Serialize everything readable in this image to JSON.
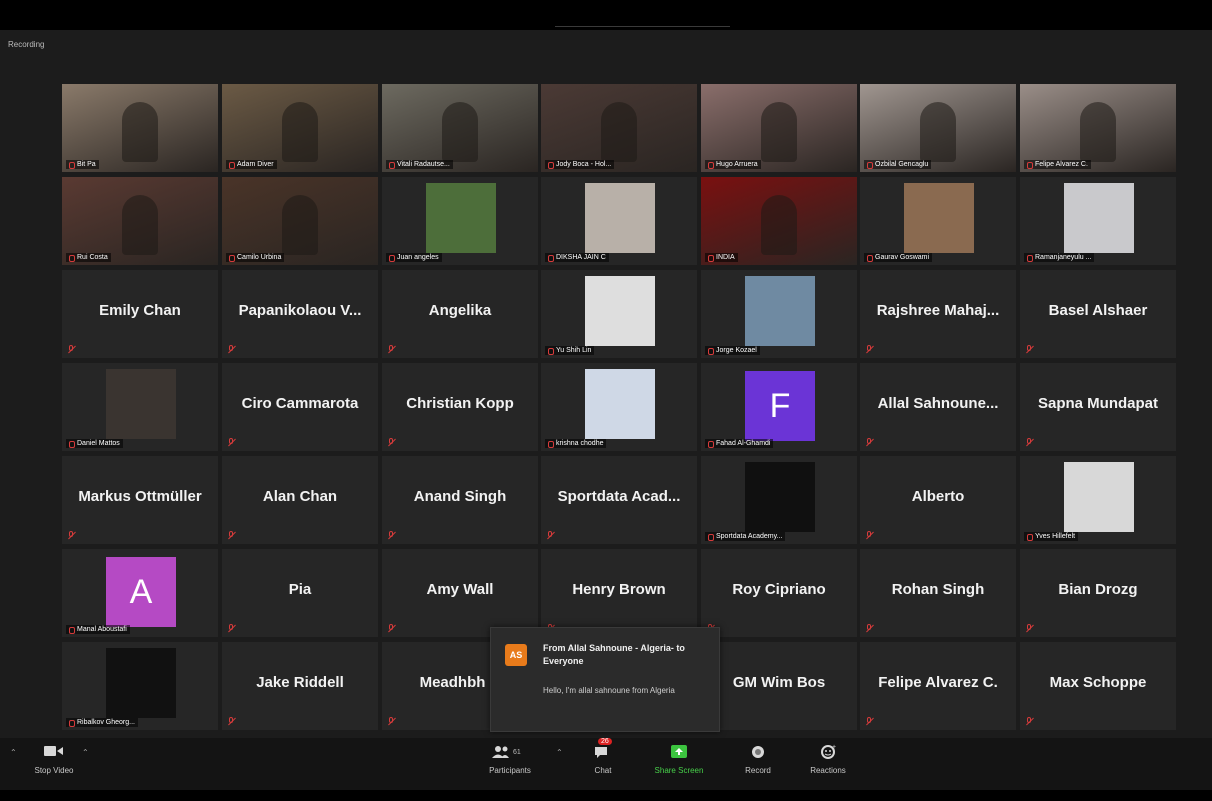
{
  "recording": "Recording",
  "tiles": [
    {
      "r": 0,
      "c": 0,
      "type": "video",
      "label": "Bit Pa",
      "active": true,
      "bg": "#8a7a6a"
    },
    {
      "r": 0,
      "c": 1,
      "type": "video",
      "label": "Adam Diver",
      "bg": "#6b5a45"
    },
    {
      "r": 0,
      "c": 2,
      "type": "video",
      "label": "Vitali Radautse...",
      "bg": "#6d6a60"
    },
    {
      "r": 0,
      "c": 3,
      "type": "video",
      "label": "Jody Boca - Hol...",
      "bg": "#4b3a35"
    },
    {
      "r": 0,
      "c": 4,
      "type": "video",
      "label": "Hugo Arruera",
      "bg": "#8a6e6b"
    },
    {
      "r": 0,
      "c": 5,
      "type": "video",
      "label": "Ozbilal Gencaglu",
      "bg": "#a09690"
    },
    {
      "r": 0,
      "c": 6,
      "type": "video",
      "label": "Felipe Alvarez C.",
      "bg": "#9a8e88"
    },
    {
      "r": 1,
      "c": 0,
      "type": "video",
      "label": "Rui Costa",
      "bg": "#5a3a32"
    },
    {
      "r": 1,
      "c": 1,
      "type": "video",
      "label": "Camilo Urbina",
      "bg": "#4a3428"
    },
    {
      "r": 1,
      "c": 2,
      "type": "thumb",
      "label": "Juan angeles",
      "bg": "#4d6e3a"
    },
    {
      "r": 1,
      "c": 3,
      "type": "thumb",
      "label": "DIKSHA JAIN C",
      "bg": "#b8b0a8"
    },
    {
      "r": 1,
      "c": 4,
      "type": "video",
      "label": "INDIA",
      "bg": "#7a1010"
    },
    {
      "r": 1,
      "c": 5,
      "type": "thumb",
      "label": "Gaurav Goswami",
      "bg": "#8a6a50"
    },
    {
      "r": 1,
      "c": 6,
      "type": "thumb",
      "label": "Ramanjaneyulu ...",
      "bg": "#c9c9cc"
    },
    {
      "r": 2,
      "c": 0,
      "type": "name",
      "name": "Emily Chan"
    },
    {
      "r": 2,
      "c": 1,
      "type": "name",
      "name": "Papanikolaou V..."
    },
    {
      "r": 2,
      "c": 2,
      "type": "name",
      "name": "Angelika"
    },
    {
      "r": 2,
      "c": 3,
      "type": "thumb",
      "label": "Yu Shih Lin",
      "bg": "#dedede"
    },
    {
      "r": 2,
      "c": 4,
      "type": "thumb",
      "label": "Jorge Kozael",
      "bg": "#6f8aa2"
    },
    {
      "r": 2,
      "c": 5,
      "type": "name",
      "name": "Rajshree  Mahaj..."
    },
    {
      "r": 2,
      "c": 6,
      "type": "name",
      "name": "Basel Alshaer"
    },
    {
      "r": 3,
      "c": 0,
      "type": "thumb",
      "label": "Daniel Mattos",
      "bg": "#3a3430"
    },
    {
      "r": 3,
      "c": 1,
      "type": "name",
      "name": "Ciro Cammarota"
    },
    {
      "r": 3,
      "c": 2,
      "type": "name",
      "name": "Christian Kopp"
    },
    {
      "r": 3,
      "c": 3,
      "type": "thumb",
      "label": "krishna chodhe",
      "bg": "#cfd8e6"
    },
    {
      "r": 3,
      "c": 4,
      "type": "avatar",
      "letter": "F",
      "label": "Fahad Al-Ghamdi",
      "bg": "#6b34d6"
    },
    {
      "r": 3,
      "c": 5,
      "type": "name",
      "name": "Allal  Sahnoune..."
    },
    {
      "r": 3,
      "c": 6,
      "type": "name",
      "name": "Sapna Mundapat"
    },
    {
      "r": 4,
      "c": 0,
      "type": "name",
      "name": "Markus Ottmüller"
    },
    {
      "r": 4,
      "c": 1,
      "type": "name",
      "name": "Alan Chan"
    },
    {
      "r": 4,
      "c": 2,
      "type": "name",
      "name": "Anand Singh"
    },
    {
      "r": 4,
      "c": 3,
      "type": "name",
      "name": "Sportdata  Acad..."
    },
    {
      "r": 4,
      "c": 4,
      "type": "thumb",
      "label": "Sportdata Academy...",
      "bg": "#101010"
    },
    {
      "r": 4,
      "c": 5,
      "type": "name",
      "name": "Alberto"
    },
    {
      "r": 4,
      "c": 6,
      "type": "thumb",
      "label": "Yves Hillefelt",
      "bg": "#d8d8d8"
    },
    {
      "r": 5,
      "c": 0,
      "type": "avatar",
      "letter": "A",
      "label": "Manal Aboustafi",
      "bg": "#b54ac4"
    },
    {
      "r": 5,
      "c": 1,
      "type": "name",
      "name": "Pia"
    },
    {
      "r": 5,
      "c": 2,
      "type": "name",
      "name": "Amy Wall"
    },
    {
      "r": 5,
      "c": 3,
      "type": "name",
      "name": "Henry Brown"
    },
    {
      "r": 5,
      "c": 4,
      "type": "name",
      "name": "Roy Cipriano"
    },
    {
      "r": 5,
      "c": 5,
      "type": "name",
      "name": "Rohan Singh"
    },
    {
      "r": 5,
      "c": 6,
      "type": "name",
      "name": "Bian Drozg"
    },
    {
      "r": 6,
      "c": 0,
      "type": "thumb",
      "label": "Ribalkov Gheorg...",
      "bg": "#111111"
    },
    {
      "r": 6,
      "c": 1,
      "type": "name",
      "name": "Jake Riddell"
    },
    {
      "r": 6,
      "c": 2,
      "type": "name",
      "name": "Meadhbh D"
    },
    {
      "r": 6,
      "c": 3,
      "type": "empty"
    },
    {
      "r": 6,
      "c": 4,
      "type": "name",
      "name": "GM Wim Bos"
    },
    {
      "r": 6,
      "c": 5,
      "type": "name",
      "name": "Felipe Alvarez C."
    },
    {
      "r": 6,
      "c": 6,
      "type": "name",
      "name": "Max Schoppe"
    }
  ],
  "toast": {
    "avatar": "AS",
    "from": "From Allal Sahnoune - Algeria- to Everyone",
    "message": "Hello, I'm allal sahnoune from Algeria"
  },
  "toolbar": {
    "stop_video": "Stop Video",
    "participants": "Participants",
    "participants_count": "61",
    "chat": "Chat",
    "chat_badge": "26",
    "share_screen": "Share Screen",
    "record": "Record",
    "reactions": "Reactions"
  },
  "colors": {
    "accent_green": "#47d14a",
    "active_border": "#d8d36a",
    "badge_red": "#dd2222"
  }
}
